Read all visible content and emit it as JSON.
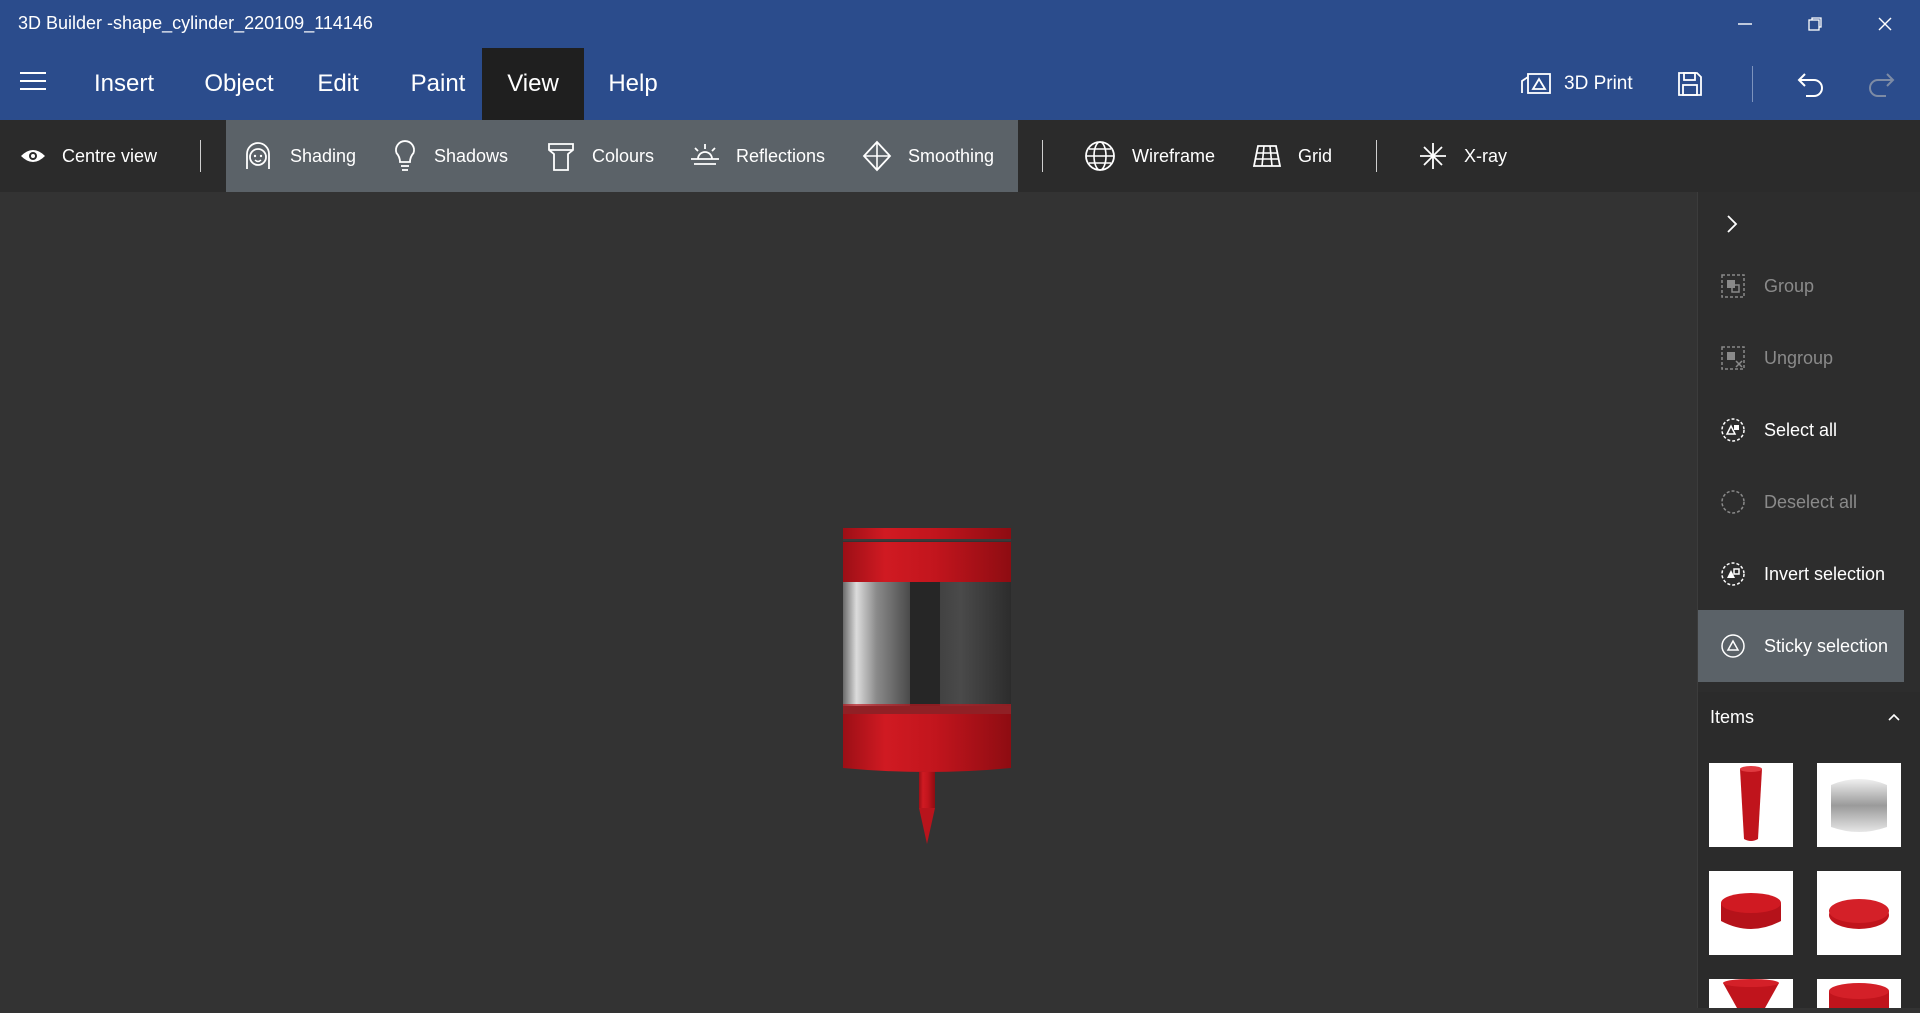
{
  "window": {
    "title": "3D Builder -shape_cylinder_220109_114146"
  },
  "menu": {
    "items": [
      "Insert",
      "Object",
      "Edit",
      "Paint",
      "View",
      "Help"
    ],
    "active": "View",
    "print_label": "3D Print"
  },
  "toolbar": {
    "centre_view": "Centre view",
    "shading": "Shading",
    "shadows": "Shadows",
    "colours": "Colours",
    "reflections": "Reflections",
    "smoothing": "Smoothing",
    "wireframe": "Wireframe",
    "grid": "Grid",
    "xray": "X-ray"
  },
  "side_panel": {
    "actions": [
      {
        "label": "Group",
        "enabled": false,
        "active": false
      },
      {
        "label": "Ungroup",
        "enabled": false,
        "active": false
      },
      {
        "label": "Select all",
        "enabled": true,
        "active": false
      },
      {
        "label": "Deselect all",
        "enabled": false,
        "active": false
      },
      {
        "label": "Invert selection",
        "enabled": true,
        "active": false
      },
      {
        "label": "Sticky selection",
        "enabled": true,
        "active": true
      }
    ],
    "items_header": "Items"
  },
  "colors": {
    "title_bar": "#2b4c8c",
    "toolbar": "#2b2b2b",
    "toolbar_group": "#5b6268",
    "viewport": "#333333",
    "model_red": "#c0141c"
  },
  "icons": {
    "menu": "hamburger-icon",
    "print": "3d-print-icon",
    "save": "save-icon",
    "undo": "undo-icon",
    "redo": "redo-icon",
    "centre_view": "eye-icon",
    "shading": "face-icon",
    "shadows": "lightbulb-icon",
    "colours": "paint-bucket-icon",
    "reflections": "sunrise-icon",
    "smoothing": "diamond-icon",
    "wireframe": "globe-icon",
    "grid": "grid-icon",
    "xray": "xray-icon"
  }
}
